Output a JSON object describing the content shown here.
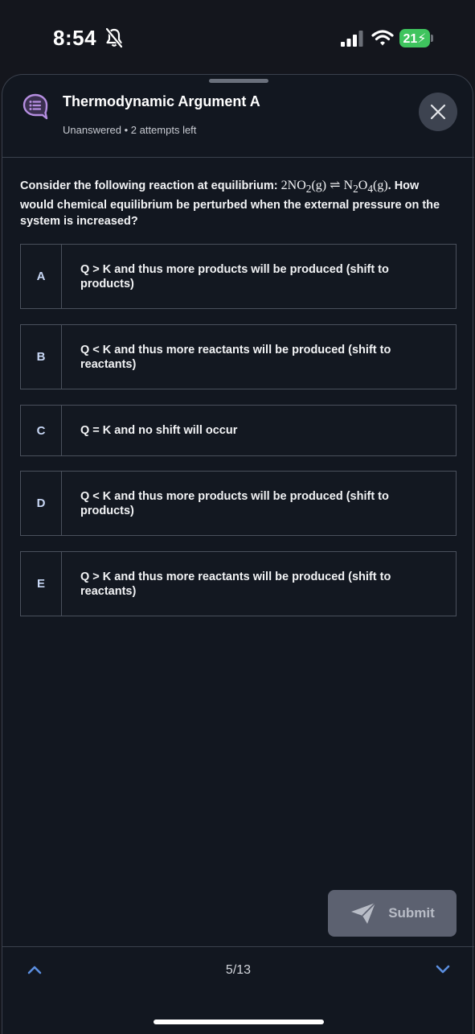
{
  "status_bar": {
    "time": "8:54",
    "battery": "21",
    "icons": [
      "bell-slash-icon",
      "cellular-signal-icon",
      "wifi-icon",
      "battery-charging-icon"
    ]
  },
  "header": {
    "icon": "quiz-list-icon",
    "title": "Thermodynamic Argument A",
    "subtitle": "Unanswered • 2 attempts left",
    "close_icon": "close-icon"
  },
  "question": {
    "prefix": "Consider the following reaction at equilibrium: ",
    "formula_reactant": "2NO",
    "formula_reactant_sub": "2",
    "formula_reactant_state": "(g)",
    "arrow": "⇌",
    "formula_product": "N",
    "formula_product_sub1": "2",
    "formula_product_mid": "O",
    "formula_product_sub2": "4",
    "formula_product_state": "(g)",
    "suffix": ". How would chemical equilibrium be perturbed when the external pressure on the system is increased?"
  },
  "options": [
    {
      "letter": "A",
      "text": "Q > K and thus more products will be produced (shift to products)"
    },
    {
      "letter": "B",
      "text": "Q < K and thus more reactants will be produced (shift to reactants)"
    },
    {
      "letter": "C",
      "text": "Q = K and no shift will occur"
    },
    {
      "letter": "D",
      "text": "Q < K and thus more products will be produced (shift to products)"
    },
    {
      "letter": "E",
      "text": "Q > K and thus more reactants will be produced (shift to reactants)"
    }
  ],
  "submit": {
    "label": "Submit",
    "icon": "paper-plane-icon"
  },
  "navigation": {
    "page": "5/13",
    "prev_icon": "chevron-up-icon",
    "next_icon": "chevron-down-icon"
  },
  "colors": {
    "background": "#14161d",
    "accent_icon": "#b58ee0",
    "nav_chevron": "#5b8fe0",
    "letter": "#c8d7f5",
    "battery": "#3fc45e"
  }
}
